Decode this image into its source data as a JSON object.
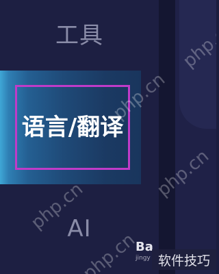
{
  "menu": {
    "tools_label": "工具",
    "active_label": "语言/翻译",
    "ai_label": "AI"
  },
  "watermarks": {
    "site": "php.cn"
  },
  "overlays": {
    "baidu": "Ba",
    "baidu_sub": "jingy",
    "site_tag": "软件技巧"
  },
  "colors": {
    "background": "#1b1d3e",
    "highlight_border": "#c03bc8",
    "active_gradient_start": "#3fa7d6",
    "active_gradient_end": "#19355d"
  }
}
